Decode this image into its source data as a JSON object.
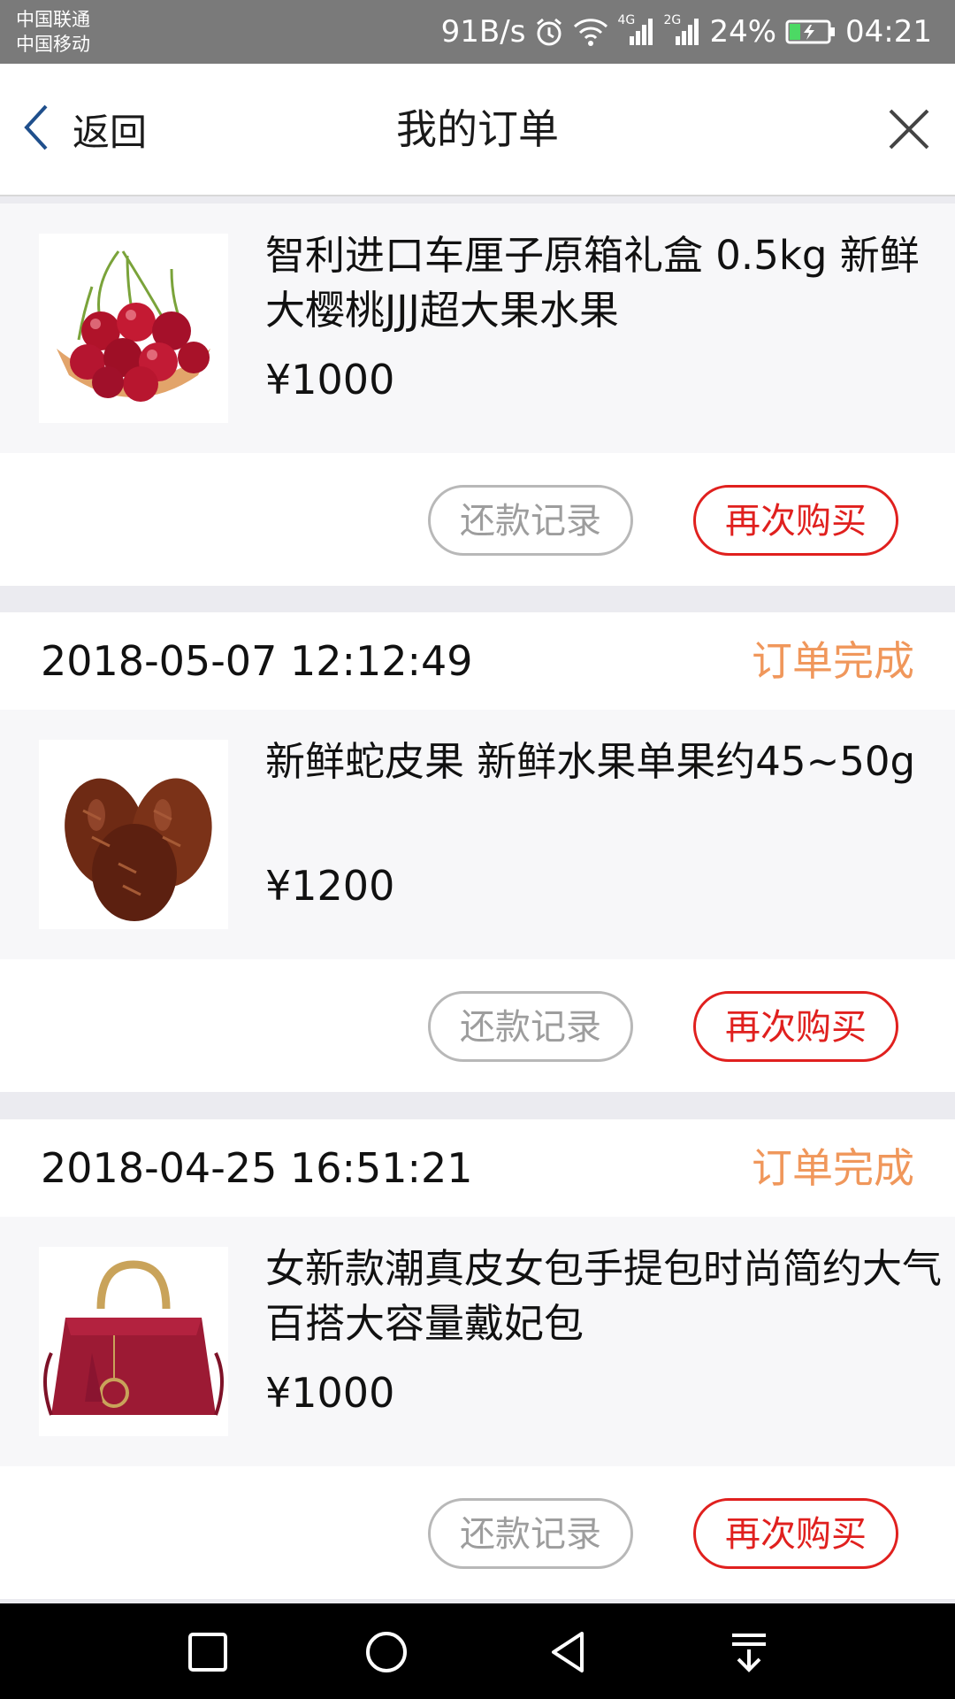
{
  "status_bar": {
    "carrier_1": "中国联通",
    "carrier_2": "中国移动",
    "net_speed": "91B/s",
    "signal_1_type": "4G",
    "signal_2_type": "2G",
    "battery": "24%",
    "time": "04:21",
    "icons": [
      "alarm-icon",
      "wifi-icon",
      "signal-icon",
      "battery-icon"
    ]
  },
  "nav": {
    "back_label": "返回",
    "title": "我的订单",
    "close_icon": "close-icon"
  },
  "orders": [
    {
      "product": {
        "title": "智利进口车厘子原箱礼盒 0.5kg 新鲜大樱桃JJJ超大果水果",
        "price": "¥1000",
        "image": "cherries"
      },
      "actions": {
        "record": "还款记录",
        "rebuy": "再次购买"
      }
    },
    {
      "date": "2018-05-07 12:12:49",
      "status": "订单完成",
      "product": {
        "title": "新鲜蛇皮果 新鲜水果单果约45~50g",
        "price": "¥1200",
        "image": "salak-fruit"
      },
      "actions": {
        "record": "还款记录",
        "rebuy": "再次购买"
      }
    },
    {
      "date": "2018-04-25 16:51:21",
      "status": "订单完成",
      "product": {
        "title": "女新款潮真皮女包手提包时尚简约大气百搭大容量戴妃包",
        "price": "¥1000",
        "image": "red-handbag"
      },
      "actions": {
        "record": "还款记录",
        "rebuy": "再次购买"
      }
    }
  ],
  "colors": {
    "status_text": "#f0975b",
    "rebuy_accent": "#e0201e",
    "back_icon": "#1f4f8c"
  },
  "system_nav": [
    "recent-apps-icon",
    "home-icon",
    "back-icon",
    "notification-pull-icon"
  ]
}
